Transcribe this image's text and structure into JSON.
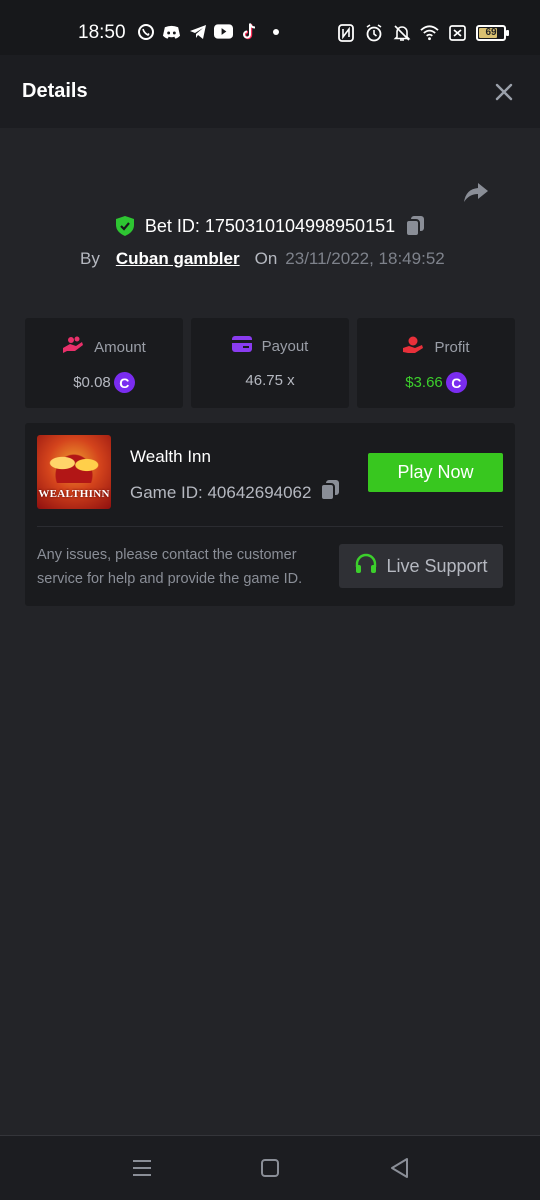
{
  "status_bar": {
    "time": "18:50",
    "app_icons": [
      "whatsapp-icon",
      "discord-icon",
      "telegram-icon",
      "youtube-icon",
      "tiktok-icon",
      "dot-icon"
    ],
    "system_icons": [
      "nfc-icon",
      "alarm-icon",
      "bell-off-icon",
      "wifi-icon",
      "sim-off-icon",
      "battery-icon"
    ],
    "battery": "69"
  },
  "header": {
    "title": "Details"
  },
  "bet": {
    "id_label": "Bet ID: 1750310104998950151",
    "by_label": "By",
    "user": "Cuban gambler",
    "on_label": "On",
    "date": "23/11/2022, 18:49:52"
  },
  "stats": {
    "amount": {
      "label": "Amount",
      "value": "$0.08",
      "icon": "coins-hand-icon",
      "color": "#e8306a"
    },
    "payout": {
      "label": "Payout",
      "value": "46.75 x",
      "icon": "card-icon",
      "color": "#8a3cf0"
    },
    "profit": {
      "label": "Profit",
      "value": "$3.66",
      "icon": "money-hand-icon",
      "color": "#e8303a"
    }
  },
  "currency_symbol": "C",
  "game": {
    "name": "Wealth Inn",
    "id_label": "Game ID: 40642694062",
    "thumb_text": "WEALTHINN",
    "play_label": "Play Now",
    "help_text": "Any issues, please contact the customer service for help and provide the game ID.",
    "support_label": "Live Support"
  },
  "colors": {
    "accent_green": "#38c71f",
    "profit_green": "#3ccf2c",
    "coin_purple": "#7a2cf0",
    "background": "#232428"
  }
}
